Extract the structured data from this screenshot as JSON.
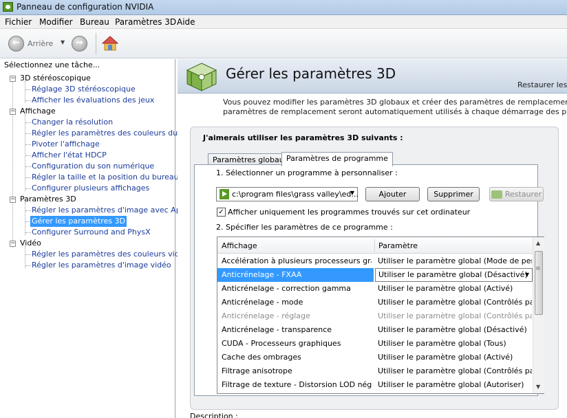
{
  "window": {
    "title": "Panneau de configuration NVIDIA"
  },
  "menu": [
    "Fichier",
    "Modifier",
    "Bureau",
    "Paramètres 3D",
    "Aide"
  ],
  "toolbar": {
    "back_label": "Arrière"
  },
  "sidebar": {
    "title": "Sélectionnez une tâche...",
    "categories": [
      {
        "label": "3D stéréoscopique",
        "items": [
          "Réglage 3D stéréoscopique",
          "Afficher les évaluations des jeux"
        ]
      },
      {
        "label": "Affichage",
        "items": [
          "Changer la résolution",
          "Régler les paramètres des couleurs du bure",
          "Pivoter l'affichage",
          "Afficher l'état HDCP",
          "Configuration du son numérique",
          "Régler la taille et la position du bureau",
          "Configurer plusieurs affichages"
        ]
      },
      {
        "label": "Paramètres 3D",
        "items": [
          "Régler les paramètres d'image avec Aperçu",
          "Gérer les paramètres 3D",
          "Configurer Surround and PhysX"
        ]
      },
      {
        "label": "Vidéo",
        "items": [
          "Régler les paramètres des couleurs vidéo",
          "Régler les paramètres d'image vidéo"
        ]
      }
    ],
    "selected": "Gérer les paramètres 3D"
  },
  "page": {
    "title": "Gérer les paramètres 3D",
    "restore_link": "Restaurer les",
    "intro_line1": "Vous pouvez modifier les paramètres 3D globaux et créer des paramètres de remplacement pour des progra",
    "intro_line2": "paramètres de remplacement seront automatiquement utilisés à chaque démarrage des programmes spécifi",
    "group_title": "J'aimerais utiliser les paramètres 3D suivants :",
    "tabs": [
      "Paramètres globaux",
      "Paramètres de programme"
    ],
    "active_tab": "Paramètres de programme",
    "step1_label": "1. Sélectionner un programme à personnaliser :",
    "program_value": "c:\\program files\\grass valley\\ed...",
    "add_label": "Ajouter",
    "remove_label": "Supprimer",
    "restore_label": "Restaurer",
    "checkbox_label": "Afficher uniquement les programmes trouvés sur cet ordinateur",
    "checkbox_checked": true,
    "step2_label": "2. Spécifier les paramètres de ce programme :",
    "table_headers": [
      "Affichage",
      "Paramètre"
    ],
    "rows": [
      [
        "Accélération à plusieurs processeurs grap...",
        "Utiliser le paramètre global (Mode de perfo..."
      ],
      [
        "Anticrénelage - FXAA",
        "Utiliser le paramètre global (Désactivé)"
      ],
      [
        "Anticrénelage - correction gamma",
        "Utiliser le paramètre global (Activé)"
      ],
      [
        "Anticrénelage - mode",
        "Utiliser le paramètre global (Contrôlés par l..."
      ],
      [
        "Anticrénelage - réglage",
        "Utiliser le paramètre global (Contrôlés par l..."
      ],
      [
        "Anticrénelage - transparence",
        "Utiliser le paramètre global (Désactivé)"
      ],
      [
        "CUDA - Processeurs graphiques",
        "Utiliser le paramètre global (Tous)"
      ],
      [
        "Cache des ombrages",
        "Utiliser le paramètre global (Activé)"
      ],
      [
        "Filtrage anisotrope",
        "Utiliser le paramètre global (Contrôlés par l..."
      ],
      [
        "Filtrage de texture - Distorsion LOD négative",
        "Utiliser le paramètre global (Autoriser)"
      ]
    ],
    "selected_row": 1,
    "disabled_row": 4,
    "description_label": "Description :"
  }
}
